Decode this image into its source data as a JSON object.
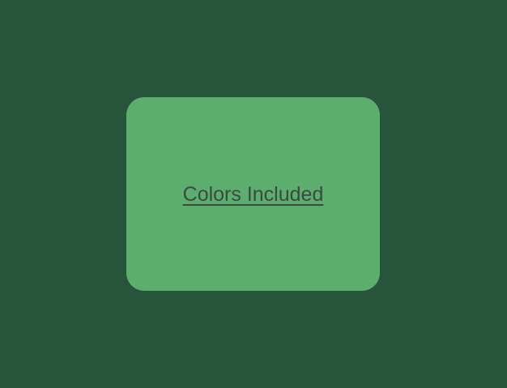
{
  "card": {
    "link_text": "Colors Included"
  },
  "colors": {
    "background": "#28543c",
    "card": "#5dae6e",
    "text": "#3a4a40"
  }
}
